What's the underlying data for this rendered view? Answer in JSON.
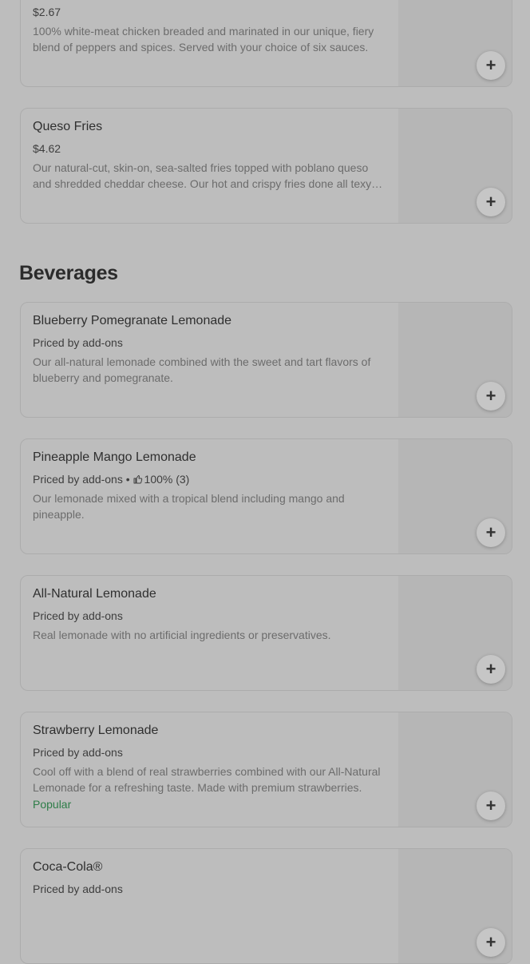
{
  "sections": {
    "beverages_title": "Beverages"
  },
  "items": [
    {
      "name": "",
      "price": "$2.67",
      "description": "100% white-meat chicken breaded and marinated in our unique, fiery blend of peppers and spices. Served with your choice of six sauces.",
      "add_label": "+"
    },
    {
      "name": "Queso Fries",
      "price": "$4.62",
      "description": "Our natural-cut, skin-on, sea-salted fries topped with poblano queso and shredded cheddar cheese. Our hot and crispy fries done all texy style.",
      "add_label": "+"
    },
    {
      "name": "Blueberry Pomegranate Lemonade",
      "price": "Priced by add-ons",
      "description": "Our all-natural lemonade combined with the sweet and tart flavors of blueberry and pomegranate.",
      "add_label": "+"
    },
    {
      "name": "Pineapple Mango Lemonade",
      "price": "Priced by add-ons",
      "separator": " • ",
      "rating_icon": "thumbs-up-icon",
      "rating": "100% (3)",
      "description": "Our lemonade mixed with a tropical blend including mango and pineapple.",
      "add_label": "+"
    },
    {
      "name": "All-Natural Lemonade",
      "price": "Priced by add-ons",
      "description": "Real lemonade with no artificial ingredients or preservatives.",
      "add_label": "+"
    },
    {
      "name": "Strawberry Lemonade",
      "price": "Priced by add-ons",
      "description": "Cool off with a blend of real strawberries combined with our All-Natural Lemonade for a refreshing taste. Made with premium strawberries.",
      "badge": "Popular",
      "add_label": "+"
    },
    {
      "name": "Coca-Cola®",
      "price": "Priced by add-ons",
      "description": "",
      "add_label": "+"
    }
  ],
  "colors": {
    "popular_badge": "#2e7d48",
    "background": "#bdbdbd"
  }
}
